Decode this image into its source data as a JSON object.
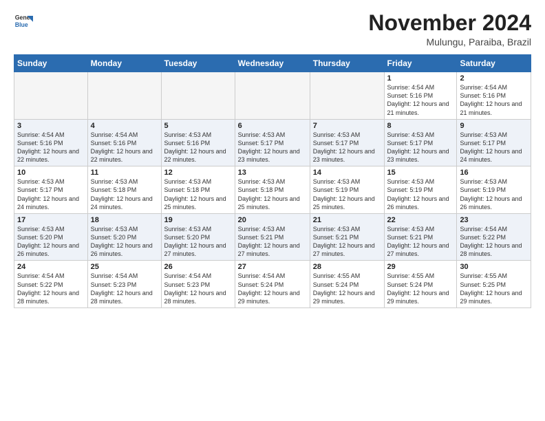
{
  "header": {
    "logo_line1": "General",
    "logo_line2": "Blue",
    "month_year": "November 2024",
    "location": "Mulungu, Paraiba, Brazil"
  },
  "weekdays": [
    "Sunday",
    "Monday",
    "Tuesday",
    "Wednesday",
    "Thursday",
    "Friday",
    "Saturday"
  ],
  "weeks": [
    [
      {
        "day": "",
        "info": ""
      },
      {
        "day": "",
        "info": ""
      },
      {
        "day": "",
        "info": ""
      },
      {
        "day": "",
        "info": ""
      },
      {
        "day": "",
        "info": ""
      },
      {
        "day": "1",
        "info": "Sunrise: 4:54 AM\nSunset: 5:16 PM\nDaylight: 12 hours and 21 minutes."
      },
      {
        "day": "2",
        "info": "Sunrise: 4:54 AM\nSunset: 5:16 PM\nDaylight: 12 hours and 21 minutes."
      }
    ],
    [
      {
        "day": "3",
        "info": "Sunrise: 4:54 AM\nSunset: 5:16 PM\nDaylight: 12 hours and 22 minutes."
      },
      {
        "day": "4",
        "info": "Sunrise: 4:54 AM\nSunset: 5:16 PM\nDaylight: 12 hours and 22 minutes."
      },
      {
        "day": "5",
        "info": "Sunrise: 4:53 AM\nSunset: 5:16 PM\nDaylight: 12 hours and 22 minutes."
      },
      {
        "day": "6",
        "info": "Sunrise: 4:53 AM\nSunset: 5:17 PM\nDaylight: 12 hours and 23 minutes."
      },
      {
        "day": "7",
        "info": "Sunrise: 4:53 AM\nSunset: 5:17 PM\nDaylight: 12 hours and 23 minutes."
      },
      {
        "day": "8",
        "info": "Sunrise: 4:53 AM\nSunset: 5:17 PM\nDaylight: 12 hours and 23 minutes."
      },
      {
        "day": "9",
        "info": "Sunrise: 4:53 AM\nSunset: 5:17 PM\nDaylight: 12 hours and 24 minutes."
      }
    ],
    [
      {
        "day": "10",
        "info": "Sunrise: 4:53 AM\nSunset: 5:17 PM\nDaylight: 12 hours and 24 minutes."
      },
      {
        "day": "11",
        "info": "Sunrise: 4:53 AM\nSunset: 5:18 PM\nDaylight: 12 hours and 24 minutes."
      },
      {
        "day": "12",
        "info": "Sunrise: 4:53 AM\nSunset: 5:18 PM\nDaylight: 12 hours and 25 minutes."
      },
      {
        "day": "13",
        "info": "Sunrise: 4:53 AM\nSunset: 5:18 PM\nDaylight: 12 hours and 25 minutes."
      },
      {
        "day": "14",
        "info": "Sunrise: 4:53 AM\nSunset: 5:19 PM\nDaylight: 12 hours and 25 minutes."
      },
      {
        "day": "15",
        "info": "Sunrise: 4:53 AM\nSunset: 5:19 PM\nDaylight: 12 hours and 26 minutes."
      },
      {
        "day": "16",
        "info": "Sunrise: 4:53 AM\nSunset: 5:19 PM\nDaylight: 12 hours and 26 minutes."
      }
    ],
    [
      {
        "day": "17",
        "info": "Sunrise: 4:53 AM\nSunset: 5:20 PM\nDaylight: 12 hours and 26 minutes."
      },
      {
        "day": "18",
        "info": "Sunrise: 4:53 AM\nSunset: 5:20 PM\nDaylight: 12 hours and 26 minutes."
      },
      {
        "day": "19",
        "info": "Sunrise: 4:53 AM\nSunset: 5:20 PM\nDaylight: 12 hours and 27 minutes."
      },
      {
        "day": "20",
        "info": "Sunrise: 4:53 AM\nSunset: 5:21 PM\nDaylight: 12 hours and 27 minutes."
      },
      {
        "day": "21",
        "info": "Sunrise: 4:53 AM\nSunset: 5:21 PM\nDaylight: 12 hours and 27 minutes."
      },
      {
        "day": "22",
        "info": "Sunrise: 4:53 AM\nSunset: 5:21 PM\nDaylight: 12 hours and 27 minutes."
      },
      {
        "day": "23",
        "info": "Sunrise: 4:54 AM\nSunset: 5:22 PM\nDaylight: 12 hours and 28 minutes."
      }
    ],
    [
      {
        "day": "24",
        "info": "Sunrise: 4:54 AM\nSunset: 5:22 PM\nDaylight: 12 hours and 28 minutes."
      },
      {
        "day": "25",
        "info": "Sunrise: 4:54 AM\nSunset: 5:23 PM\nDaylight: 12 hours and 28 minutes."
      },
      {
        "day": "26",
        "info": "Sunrise: 4:54 AM\nSunset: 5:23 PM\nDaylight: 12 hours and 28 minutes."
      },
      {
        "day": "27",
        "info": "Sunrise: 4:54 AM\nSunset: 5:24 PM\nDaylight: 12 hours and 29 minutes."
      },
      {
        "day": "28",
        "info": "Sunrise: 4:55 AM\nSunset: 5:24 PM\nDaylight: 12 hours and 29 minutes."
      },
      {
        "day": "29",
        "info": "Sunrise: 4:55 AM\nSunset: 5:24 PM\nDaylight: 12 hours and 29 minutes."
      },
      {
        "day": "30",
        "info": "Sunrise: 4:55 AM\nSunset: 5:25 PM\nDaylight: 12 hours and 29 minutes."
      }
    ]
  ]
}
